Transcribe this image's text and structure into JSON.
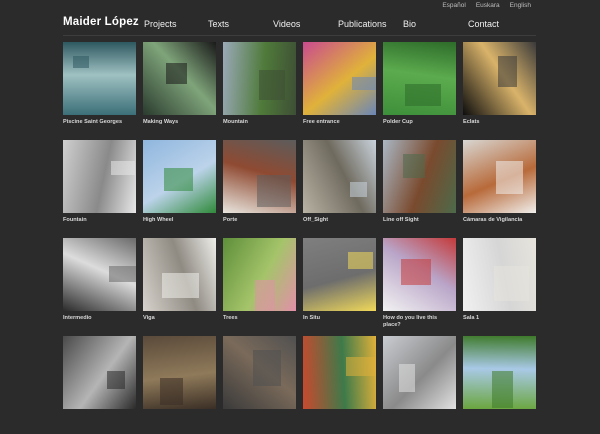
{
  "site": {
    "title": "Maider López",
    "languages": [
      "Español",
      "Euskara",
      "English"
    ],
    "nav": [
      "Projects",
      "Texts",
      "Videos",
      "Publications",
      "Bio",
      "Contact"
    ]
  },
  "projects": [
    {
      "label": "Piscine Saint Georges",
      "icon": "pool-swimmers-image",
      "colors": [
        "#3b6f78",
        "#9fc1c2",
        "#2e5860"
      ]
    },
    {
      "label": "Making Ways",
      "icon": "installation-room-image",
      "colors": [
        "#2a3b2e",
        "#7fa47a",
        "#1a1a1a"
      ]
    },
    {
      "label": "Mountain",
      "icon": "park-hill-image",
      "colors": [
        "#9aa9b8",
        "#4f7a3a",
        "#3e4f35"
      ]
    },
    {
      "label": "Free entrance",
      "icon": "colorful-building-image",
      "colors": [
        "#c94a8f",
        "#e0b23a",
        "#6a86b8"
      ]
    },
    {
      "label": "Polder Cup",
      "icon": "football-field-image",
      "colors": [
        "#3e8f3a",
        "#5cab4e",
        "#2d6b2a"
      ]
    },
    {
      "label": "Eclats",
      "icon": "dome-night-image",
      "colors": [
        "#0d0d0d",
        "#d9b36a",
        "#3a3a3a"
      ]
    },
    {
      "label": "Fountain",
      "icon": "fountain-wall-image",
      "colors": [
        "#cfcfcf",
        "#8a8a8a",
        "#e8e8e8"
      ]
    },
    {
      "label": "High Wheel",
      "icon": "balloons-sky-image",
      "colors": [
        "#8fb6de",
        "#bcd3ea",
        "#2f8a3a"
      ]
    },
    {
      "label": "Porte",
      "icon": "doorway-image",
      "colors": [
        "#e9e6df",
        "#8f4a32",
        "#5c5c5c"
      ]
    },
    {
      "label": "Off_Sight",
      "icon": "street-trees-image",
      "colors": [
        "#b9b3a5",
        "#6f6a5e",
        "#c9d3dc"
      ]
    },
    {
      "label": "Line off Sight",
      "icon": "city-skyline-image",
      "colors": [
        "#a9b7c4",
        "#7a4a2e",
        "#4c6a4a"
      ]
    },
    {
      "label": "Cámaras de Vigilancia",
      "icon": "gallery-wood-image",
      "colors": [
        "#d8d6d2",
        "#b86a3a",
        "#f0efec"
      ]
    },
    {
      "label": "Intermedio",
      "icon": "floor-plan-model-image",
      "colors": [
        "#2a2a2a",
        "#dcdcdc",
        "#6a6a6a"
      ]
    },
    {
      "label": "Viga",
      "icon": "corridor-image",
      "colors": [
        "#d7d3cc",
        "#8f8a82",
        "#eeeeea"
      ]
    },
    {
      "label": "Trees",
      "icon": "garden-trees-image",
      "colors": [
        "#5e8f3a",
        "#a5c46a",
        "#e28fa9"
      ]
    },
    {
      "label": "In Situ",
      "icon": "pavement-square-image",
      "colors": [
        "#7f7f7f",
        "#6d6d6d",
        "#f0d95a"
      ]
    },
    {
      "label": "How do you live this place?",
      "icon": "street-map-image",
      "colors": [
        "#f2f2f2",
        "#b9a5c8",
        "#c43a3a"
      ]
    },
    {
      "label": "Sala 1",
      "icon": "white-room-image",
      "colors": [
        "#f1f1f1",
        "#d6d6d6",
        "#e6e4dc"
      ]
    },
    {
      "label": "",
      "icon": "scrap-metal-image",
      "colors": [
        "#4a4a4a",
        "#b5b5b5",
        "#2a2a2a"
      ]
    },
    {
      "label": "",
      "icon": "crowd-street-image",
      "colors": [
        "#5a4a3a",
        "#8f7a5a",
        "#3a2e25"
      ]
    },
    {
      "label": "",
      "icon": "debris-image",
      "colors": [
        "#3a3a3a",
        "#7a6a5a",
        "#505050"
      ]
    },
    {
      "label": "",
      "icon": "colored-facades-image",
      "colors": [
        "#c9492e",
        "#3e7a4a",
        "#e0b03a"
      ]
    },
    {
      "label": "",
      "icon": "city-plaza-image",
      "colors": [
        "#c9ccd1",
        "#8a8a8a",
        "#e2e2e2"
      ]
    },
    {
      "label": "",
      "icon": "green-hills-image",
      "colors": [
        "#6aa63e",
        "#a9c9e6",
        "#3e7a2a"
      ]
    }
  ]
}
